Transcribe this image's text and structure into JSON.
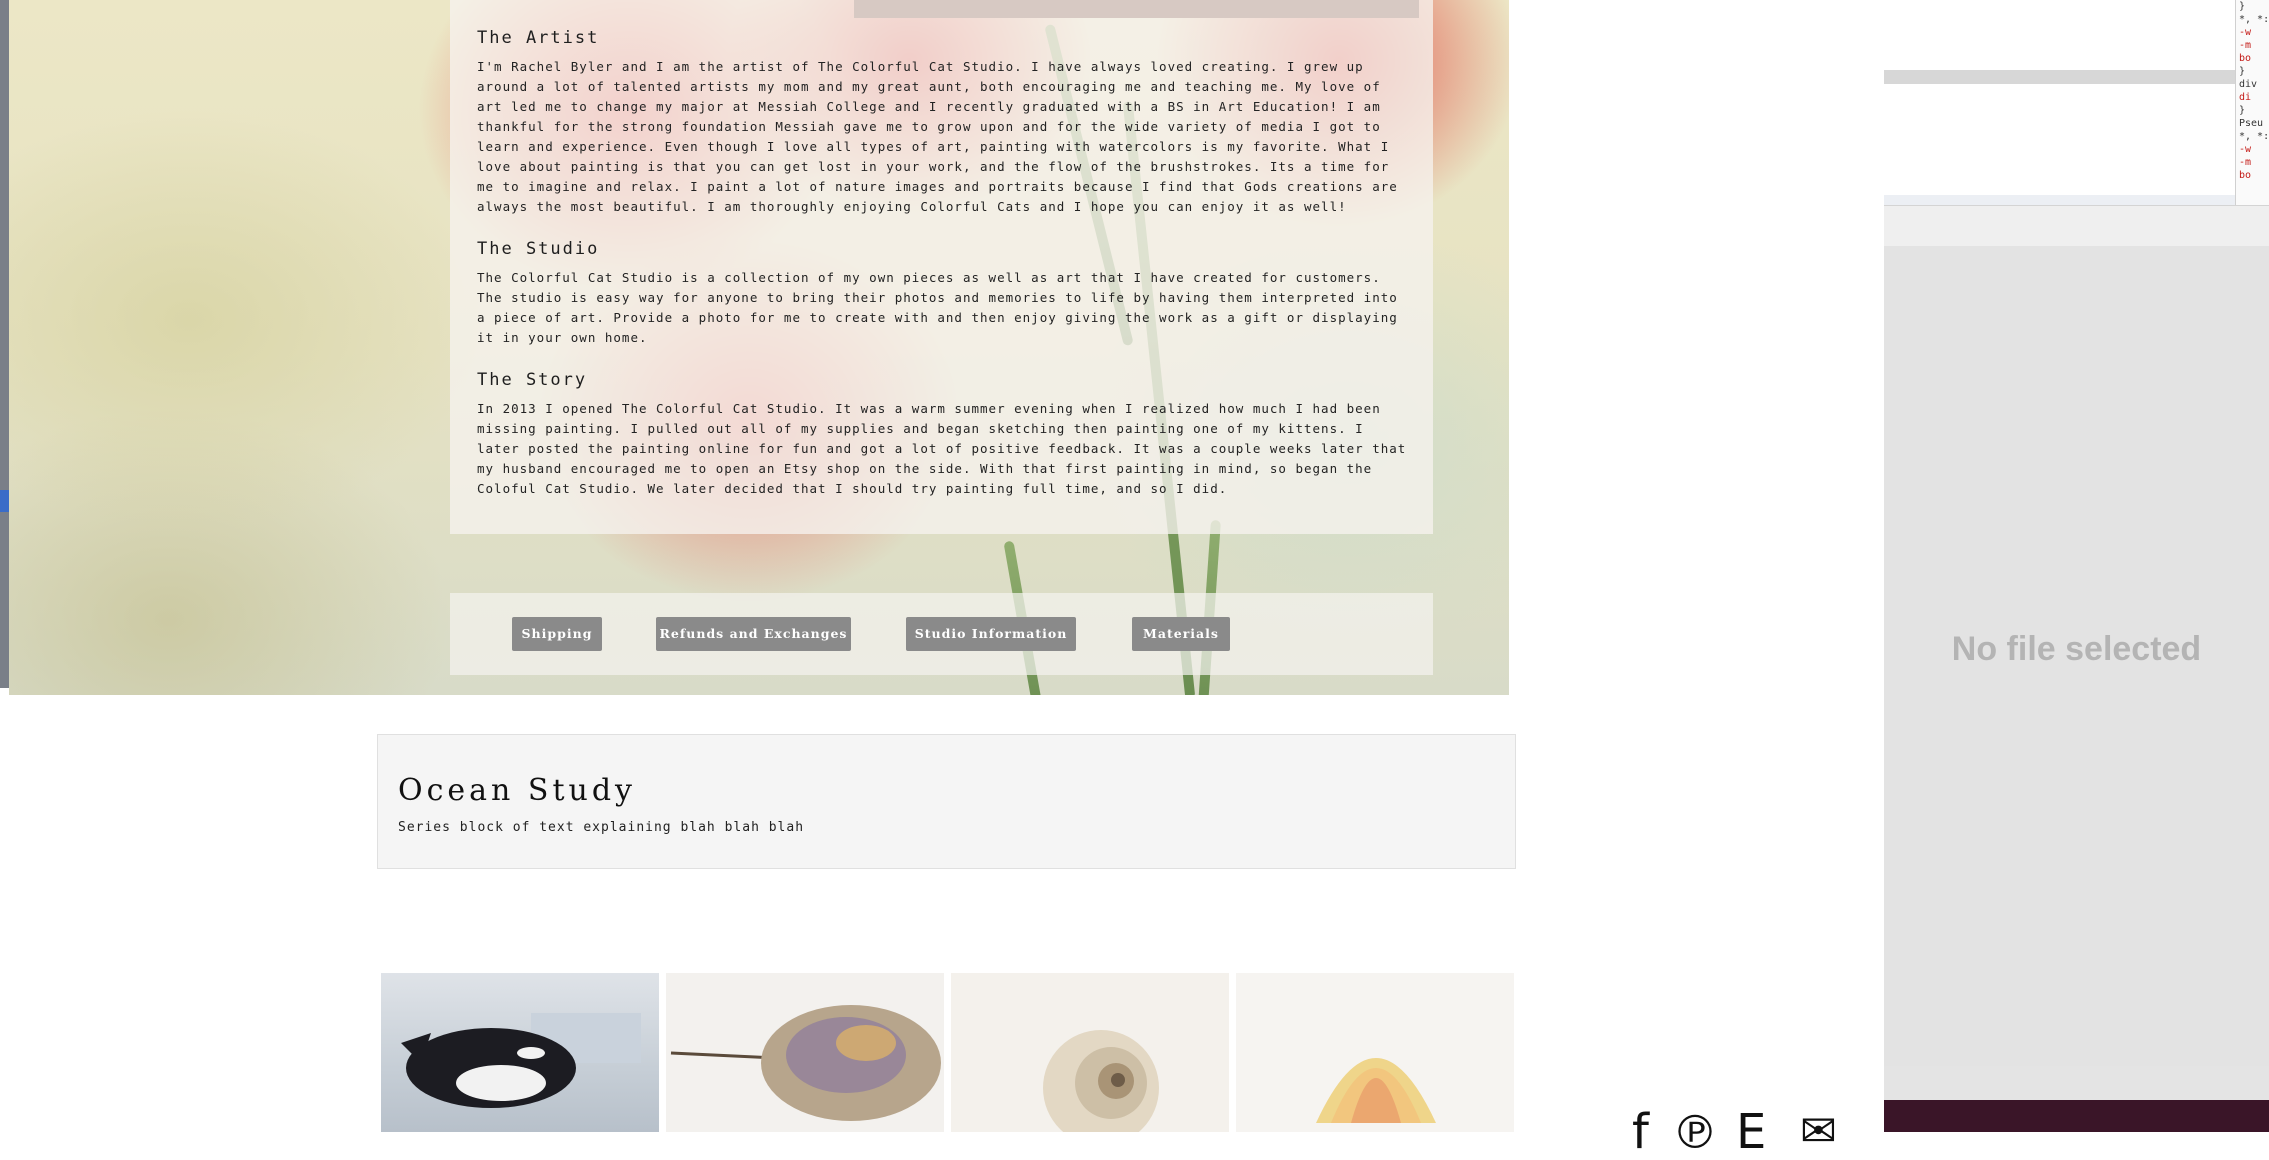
{
  "about": {
    "artist_title": "The Artist",
    "artist_body": "I'm Rachel Byler and I am the artist of The Colorful Cat Studio. I have always loved creating. I grew up around a lot of talented artists my mom and my great aunt, both encouraging me and teaching me. My love of art led me to change my major at Messiah College and I recently graduated with a BS in Art Education! I am thankful for the strong foundation Messiah gave me to grow upon and for the wide variety of media I got to learn and experience. Even though I love all types of art, painting with watercolors is my favorite. What I love about painting is that you can get lost in your work, and the flow of the brushstrokes. Its a time for me to imagine and relax. I paint a lot of nature images and portraits because I find that Gods creations are always the most beautiful. I am thoroughly enjoying Colorful Cats and I hope you can enjoy it as well!",
    "studio_title": "The Studio",
    "studio_body": "The Colorful Cat Studio is a collection of my own pieces as well as art that I have created for customers. The studio is easy way for anyone to bring their photos and memories to life by having them interpreted into a piece of art. Provide a photo for me to create with and then enjoy giving the work as a gift or displaying it in your own home.",
    "story_title": "The Story",
    "story_body": "In 2013 I opened The Colorful Cat Studio. It was a warm summer evening when I realized how much I had been missing painting. I pulled out all of my supplies and began sketching then painting one of my kittens. I later posted the painting online for fun and got a lot of positive feedback. It was a couple weeks later that my husband encouraged me to open an Etsy shop on the side. With that first painting in mind, so began the Coloful Cat Studio. We later decided that I should try painting full time, and so I did."
  },
  "buttons": {
    "shipping": "Shipping",
    "refunds": "Refunds and Exchanges",
    "studio_info": "Studio Information",
    "materials": "Materials"
  },
  "series": {
    "title": "Ocean Study",
    "description": "Series block of text explaining blah blah blah"
  },
  "gallery": {
    "items": [
      "orca-painting",
      "horseshoe-crab-painting",
      "nautilus-shell-painting",
      "scallop-shell-painting"
    ]
  },
  "viewer": {
    "empty_message": "No file selected"
  },
  "social_icons": [
    "facebook-icon",
    "pinterest-icon",
    "etsy-icon",
    "email-icon"
  ],
  "devtools_snippet": {
    "lines": [
      "}",
      "*, *:",
      "-w",
      "-m",
      "bo",
      "}",
      "div",
      "di",
      "}",
      "Pseu",
      "*, *:",
      "-w",
      "-m",
      "bo"
    ]
  },
  "colors": {
    "button_bg": "#8a8a8a",
    "button_text": "#ffffff",
    "poppy_red": "#e2342f",
    "viewer_bg": "#e3e3e3",
    "empty_text": "#b4b4b4"
  }
}
